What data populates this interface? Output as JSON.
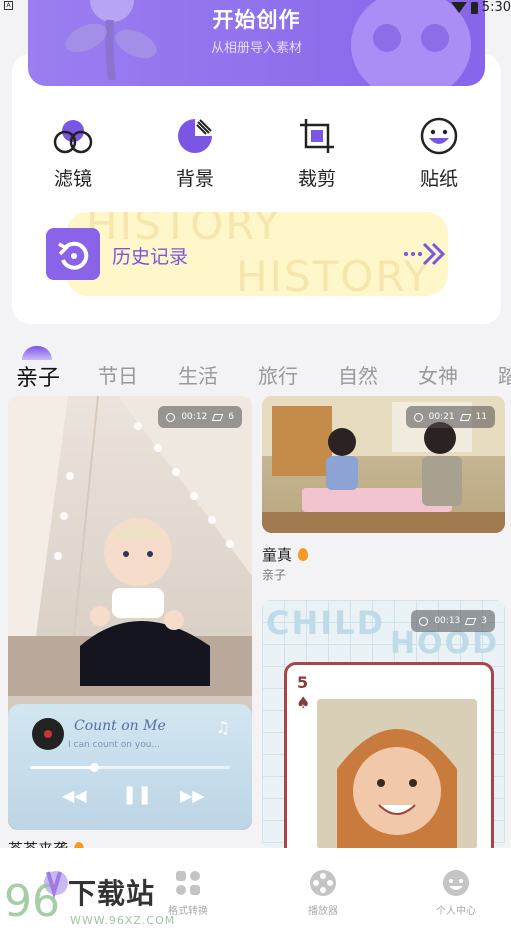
{
  "status_bar": {
    "notification_glyph": "A",
    "time": "5:30"
  },
  "hero": {
    "title": "开始创作",
    "subtitle": "从相册导入素材",
    "gradient_start": "#9a7ff0",
    "gradient_end": "#8765ea"
  },
  "tools": [
    {
      "label": "滤镜",
      "icon": "filter-icon"
    },
    {
      "label": "背景",
      "icon": "background-icon"
    },
    {
      "label": "裁剪",
      "icon": "crop-icon"
    },
    {
      "label": "贴纸",
      "icon": "sticker-icon"
    }
  ],
  "history": {
    "label": "历史记录",
    "watermark": "HISTORY",
    "icon": "history-icon",
    "arrow_icon": "more-arrow-icon"
  },
  "categories": {
    "active_index": 0,
    "items": [
      "亲子",
      "节日",
      "生活",
      "旅行",
      "自然",
      "女神",
      "踏"
    ]
  },
  "cards": {
    "left": {
      "duration": "00:12",
      "layers": "6",
      "title": "茶茶来袭",
      "player": {
        "song_title": "Count on Me",
        "song_subtitle": "I can count on you...",
        "progress": 0.32,
        "prev_glyph": "◀◀",
        "pause_glyph": "❚❚",
        "next_glyph": "▶▶",
        "note_glyph": "♫"
      }
    },
    "right_top": {
      "duration": "00:21",
      "layers": "11",
      "title": "童真",
      "category": "亲子"
    },
    "right_bottom": {
      "duration": "00:13",
      "layers": "3",
      "word_top": "CHILD",
      "word_bottom": "HOOD",
      "card_number": "5",
      "card_suit": "♠"
    }
  },
  "bottom_nav": [
    {
      "label": "",
      "icon": "home-icon"
    },
    {
      "label": "格式转换",
      "icon": "format-convert-icon"
    },
    {
      "label": "播放器",
      "icon": "player-icon"
    },
    {
      "label": "个人中心",
      "icon": "profile-icon"
    }
  ],
  "watermark": {
    "text": "下载站",
    "url": "WWW.96XZ.COM",
    "logo_text": "96"
  },
  "colors": {
    "accent": "#8765ea",
    "history_bg": "#fff6c9",
    "flame": "#f59a23"
  }
}
